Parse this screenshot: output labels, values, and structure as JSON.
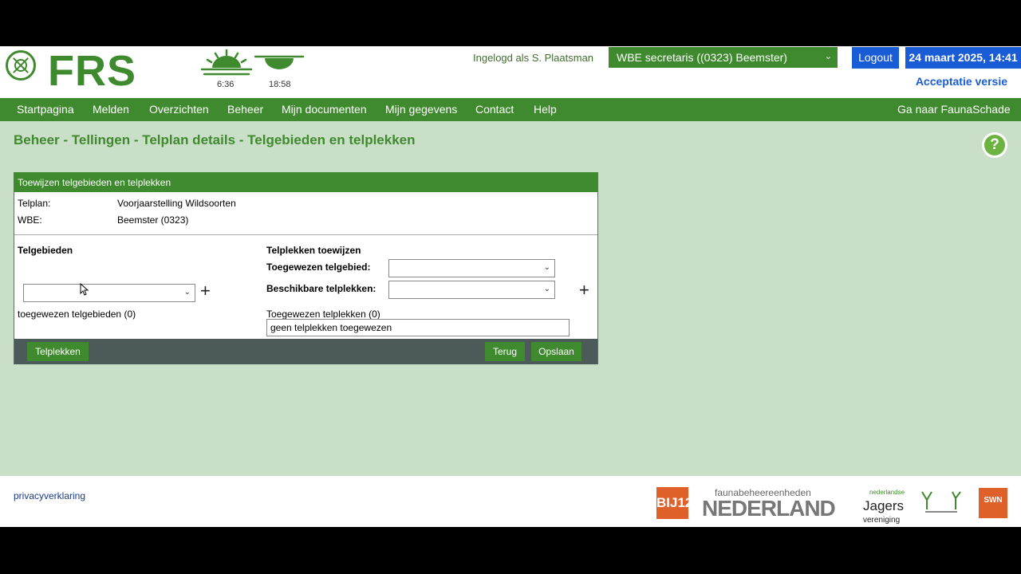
{
  "header": {
    "logo_text": "FRS",
    "sunrise": "6:36",
    "sunset": "18:58",
    "login_text": "Ingelogd als S. Plaatsman",
    "role": "WBE secretaris ((0323) Beemster)",
    "logout_label": "Logout",
    "datetime": "24 maart 2025, 14:41",
    "environment": "Acceptatie versie"
  },
  "nav": {
    "items": [
      "Startpagina",
      "Melden",
      "Overzichten",
      "Beheer",
      "Mijn documenten",
      "Mijn gegevens",
      "Contact",
      "Help"
    ],
    "right": "Ga naar FaunaSchade"
  },
  "page_title": "Beheer - Tellingen - Telplan details - Telgebieden en telplekken",
  "panel": {
    "title": "Toewijzen telgebieden en telplekken",
    "telplan_label": "Telplan:",
    "telplan_value": "Voorjaarstelling Wildsoorten",
    "wbe_label": "WBE:",
    "wbe_value": "Beemster (0323)",
    "telgebieden_heading": "Telgebieden",
    "telgebieden_select": "",
    "telgebieden_count": "toegewezen telgebieden (0)",
    "telplekken_heading": "Telplekken toewijzen",
    "toegewezen_telgebied_label": "Toegewezen telgebied:",
    "toegewezen_telgebied_value": "",
    "beschikbare_label": "Beschikbare telplekken:",
    "beschikbare_value": "",
    "toegewezen_telplekken_label": "Toegewezen telplekken (0)",
    "toegewezen_telplekken_value": "geen telplekken toegewezen",
    "btn_telplekken": "Telplekken",
    "btn_terug": "Terug",
    "btn_opslaan": "Opslaan"
  },
  "footer": {
    "privacy": "privacyverklaring",
    "logo_bij12": "BIJ12",
    "fbe_small": "faunabeheereenheden",
    "fbe_big": "NEDERLAND",
    "jagers_top": "nederlandse",
    "jagers": "Jagers",
    "jagers_sub": "vereniging",
    "swn": "SWN"
  },
  "colors": {
    "green": "#3f8a2e",
    "blue": "#1a5bd6",
    "background": "#cadfc8",
    "footer_bar": "#4d5a5a"
  }
}
